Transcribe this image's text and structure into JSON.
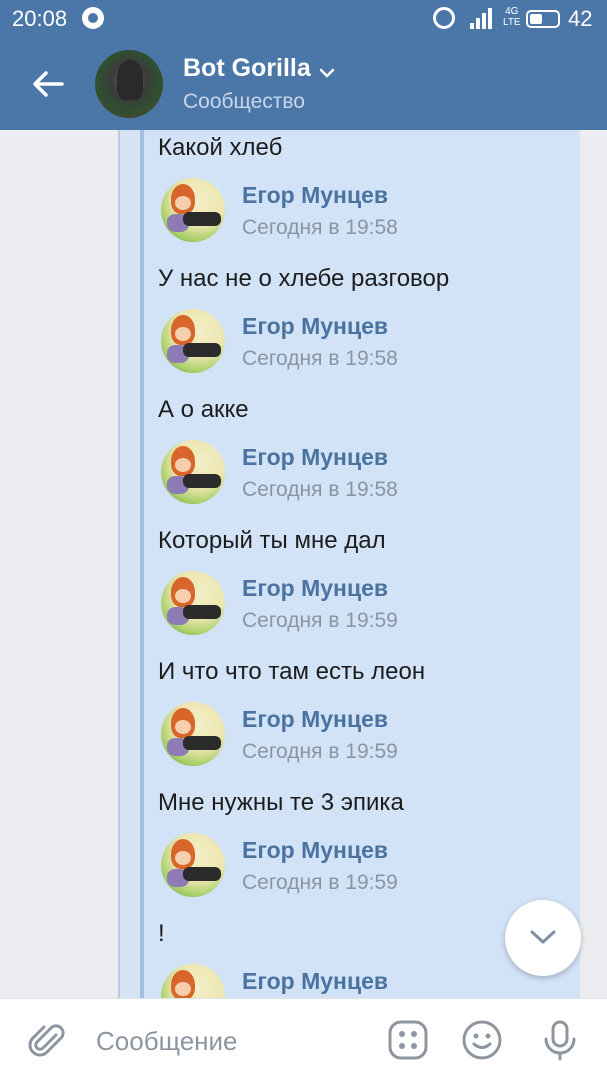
{
  "status_bar": {
    "time": "20:08",
    "network": "4G\nLTE",
    "battery": "42",
    "icons": [
      "whatsapp-icon",
      "alarm-icon",
      "signal-icon",
      "battery-icon"
    ]
  },
  "header": {
    "title": "Bot Gorilla",
    "subtitle": "Сообщество",
    "icons": [
      "back-arrow-icon",
      "chevron-down-icon"
    ],
    "color": "#4a76a8"
  },
  "messages": [
    {
      "text": "Какой хлеб"
    },
    {
      "author": "Егор Мунцев",
      "time": "Сегодня в 19:58",
      "text": "У нас не о хлебе разговор"
    },
    {
      "author": "Егор Мунцев",
      "time": "Сегодня в 19:58",
      "text": "А о акке"
    },
    {
      "author": "Егор Мунцев",
      "time": "Сегодня в 19:58",
      "text": "Который ты мне дал"
    },
    {
      "author": "Егор Мунцев",
      "time": "Сегодня в 19:59",
      "text": "И что что там есть леон"
    },
    {
      "author": "Егор Мунцев",
      "time": "Сегодня в 19:59",
      "text": "Мне нужны те 3 эпика"
    },
    {
      "author": "Егор Мунцев",
      "time": "Сегодня в 19:59",
      "text": "!"
    },
    {
      "author": "Егор Мунцев"
    }
  ],
  "composer": {
    "placeholder": "Сообщение",
    "icons": [
      "paperclip-icon",
      "apps-icon",
      "smile-icon",
      "microphone-icon"
    ]
  },
  "colors": {
    "accent": "#4a76a8",
    "author_name": "#4a73a0",
    "quote_background": "#d2e3f7"
  }
}
